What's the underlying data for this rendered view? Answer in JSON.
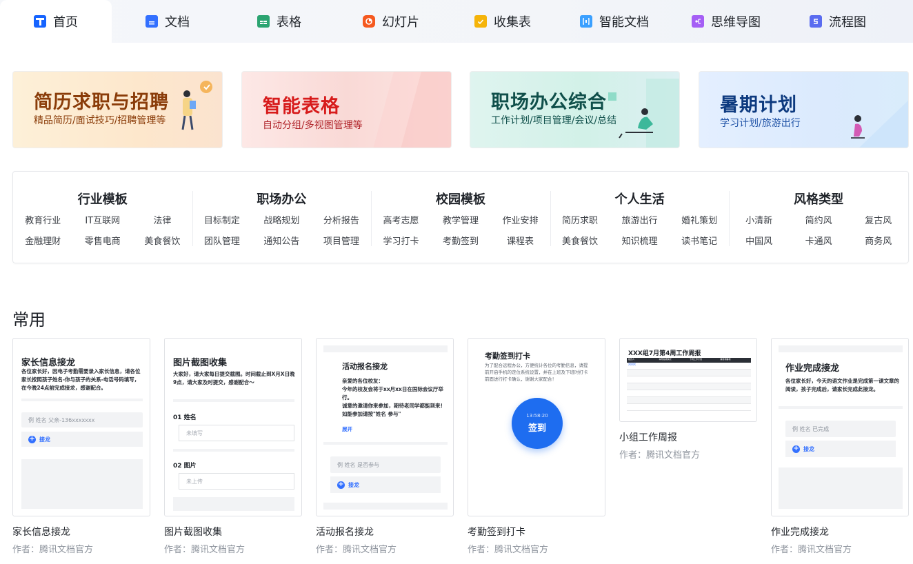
{
  "tabs": [
    {
      "label": "首页",
      "icon": "home-icon",
      "color": "#1664ff"
    },
    {
      "label": "文档",
      "icon": "doc-icon",
      "color": "#3370ff"
    },
    {
      "label": "表格",
      "icon": "sheet-icon",
      "color": "#2ba471"
    },
    {
      "label": "幻灯片",
      "icon": "slide-icon",
      "color": "#f5591f"
    },
    {
      "label": "收集表",
      "icon": "form-icon",
      "color": "#f5b40a"
    },
    {
      "label": "智能文档",
      "icon": "smart-doc-icon",
      "color": "#3ba0ff"
    },
    {
      "label": "思维导图",
      "icon": "mindmap-icon",
      "color": "#a55ef5"
    },
    {
      "label": "流程图",
      "icon": "flowchart-icon",
      "color": "#5a6cf0"
    }
  ],
  "banners": [
    {
      "title": "简历求职与招聘",
      "subtitle": "精品简历/面试技巧/招聘管理等"
    },
    {
      "title": "智能表格",
      "subtitle": "自动分组/多视图管理等"
    },
    {
      "title": "职场办公综合",
      "subtitle": "工作计划/项目管理/会议/总结"
    },
    {
      "title": "暑期计划",
      "subtitle": "学习计划/旅游出行"
    }
  ],
  "categories": [
    {
      "title": "行业模板",
      "items": [
        "教育行业",
        "IT互联网",
        "法律",
        "金融理财",
        "零售电商",
        "美食餐饮"
      ]
    },
    {
      "title": "职场办公",
      "items": [
        "目标制定",
        "战略规划",
        "分析报告",
        "团队管理",
        "通知公告",
        "项目管理"
      ]
    },
    {
      "title": "校园模板",
      "items": [
        "高考志愿",
        "教学管理",
        "作业安排",
        "学习打卡",
        "考勤签到",
        "课程表"
      ]
    },
    {
      "title": "个人生活",
      "items": [
        "简历求职",
        "旅游出行",
        "婚礼策划",
        "美食餐饮",
        "知识梳理",
        "读书笔记"
      ]
    },
    {
      "title": "风格类型",
      "items": [
        "小清新",
        "简约风",
        "复古风",
        "中国风",
        "卡通风",
        "商务风"
      ]
    }
  ],
  "section_title": "常用",
  "templates": [
    {
      "name": "家长信息接龙",
      "author": "作者：腾讯文档官方",
      "preview": {
        "title": "家长信息接龙",
        "text": "各位家长好，因电子考勤需要录入家长信息，请各位家长按照孩子姓名-你与孩子的关系-电话号码填写，在今晚24点前完成接龙，感谢配合。",
        "row": "例  姓名  父亲-136xxxxxxx",
        "add": "接龙"
      }
    },
    {
      "name": "图片截图收集",
      "author": "作者：腾讯文档官方",
      "preview": {
        "title": "图片截图收集",
        "text": "大家好，请大家每日提交截图。时间截止到X月X日晚9点，请大家及时提交，感谢配合～",
        "q1": "01 姓名",
        "q1_placeholder": "未填写",
        "q2": "02 图片",
        "q2_placeholder": "未上传"
      }
    },
    {
      "name": "活动报名接龙",
      "author": "作者：腾讯文档官方",
      "preview": {
        "title": "活动报名接龙",
        "text": "亲爱的各位校友：\n今年的校友会将于xx月xx日在国际会议厅举行。\n诚意的邀请你来参加，期待老同学都能到来！如能参加请按\"姓名 参与\"",
        "expand": "展开",
        "row": "例  姓名  是否参与",
        "add": "接龙"
      }
    },
    {
      "name": "考勤签到打卡",
      "author": "作者：腾讯文档官方",
      "preview": {
        "title": "考勤签到打卡",
        "text": "为了配合远程办公，方便统计各位的考勤信息，请提前开启手机的定位系统设置，并在上班及下班时打卡前面进行打卡确认，谢谢大家配合！",
        "time": "13:58:20",
        "button": "签到"
      }
    },
    {
      "name": "小组工作周报",
      "author": "作者：腾讯文档官方",
      "preview": {
        "title": "XXX组7月第4周工作周报",
        "headers": [
          "组员人",
          "本周完成情况",
          "下周工作计划",
          "需协调事项"
        ],
        "first_cell": "XXXX"
      }
    },
    {
      "name": "作业完成接龙",
      "author": "作者：腾讯文档官方",
      "preview": {
        "title": "作业完成接龙",
        "text": "各位家长好，今天的语文作业是完成第一课文章的阅读，孩子完成后，请家长完成此接龙。",
        "row": "例  姓名  已完成",
        "add": "接龙"
      }
    }
  ]
}
